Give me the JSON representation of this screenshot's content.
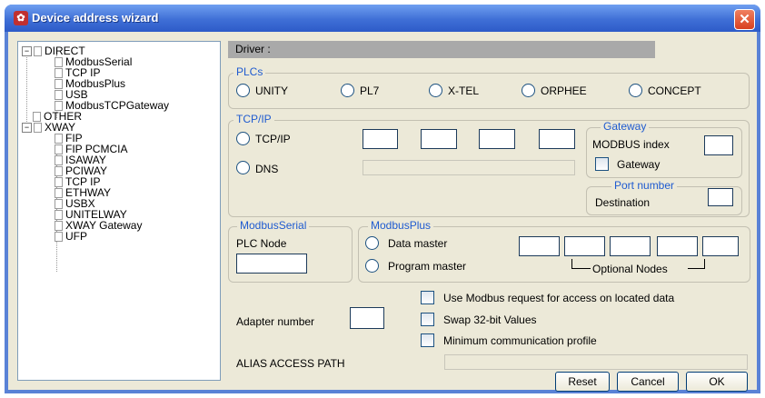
{
  "window": {
    "title": "Device address wizard",
    "close": "✕"
  },
  "tree": {
    "direct": {
      "label": "DIRECT",
      "toggle": "−",
      "children": [
        "ModbusSerial",
        "TCP IP",
        "ModbusPlus",
        "USB",
        "ModbusTCPGateway"
      ]
    },
    "other": {
      "label": "OTHER"
    },
    "xway": {
      "label": "XWAY",
      "toggle": "−",
      "children": [
        "FIP",
        "FIP PCMCIA",
        "ISAWAY",
        "PCIWAY",
        "TCP IP",
        "ETHWAY",
        "USBX",
        "UNITELWAY",
        "XWAY Gateway",
        "UFP"
      ]
    }
  },
  "driver": {
    "label": "Driver :",
    "value": ""
  },
  "plcs": {
    "legend": "PLCs",
    "options": [
      "UNITY",
      "PL7",
      "X-TEL",
      "ORPHEE",
      "CONCEPT"
    ]
  },
  "tcpip": {
    "legend": "TCP/IP",
    "tcpip_label": "TCP/IP",
    "dns_label": "DNS",
    "ip": [
      "",
      "",
      "",
      ""
    ],
    "dns_value": ""
  },
  "gateway": {
    "legend": "Gateway",
    "modbus_index_label": "MODBUS index",
    "modbus_index_value": "",
    "gateway_label": "Gateway"
  },
  "port": {
    "legend": "Port number",
    "destination_label": "Destination",
    "destination_value": ""
  },
  "modbus_serial": {
    "legend": "ModbusSerial",
    "plc_node_label": "PLC Node",
    "plc_node_value": ""
  },
  "modbus_plus": {
    "legend": "ModbusPlus",
    "data_master": "Data master",
    "program_master": "Program master",
    "nodes": [
      "",
      "",
      "",
      "",
      ""
    ],
    "optional_nodes": "Optional Nodes"
  },
  "options": {
    "use_modbus": "Use Modbus request for access on located data",
    "swap": "Swap 32-bit Values",
    "minimum": "Minimum communication profile"
  },
  "adapter": {
    "label": "Adapter number",
    "value": ""
  },
  "alias": {
    "label": "ALIAS ACCESS PATH",
    "value": ""
  },
  "buttons": {
    "reset": "Reset",
    "cancel": "Cancel",
    "ok": "OK"
  },
  "colors": {
    "title_blue": "#2d5bc8",
    "legend_blue": "#1f5bd0",
    "dialog_bg": "#ece9d8",
    "close_red": "#d84020"
  }
}
